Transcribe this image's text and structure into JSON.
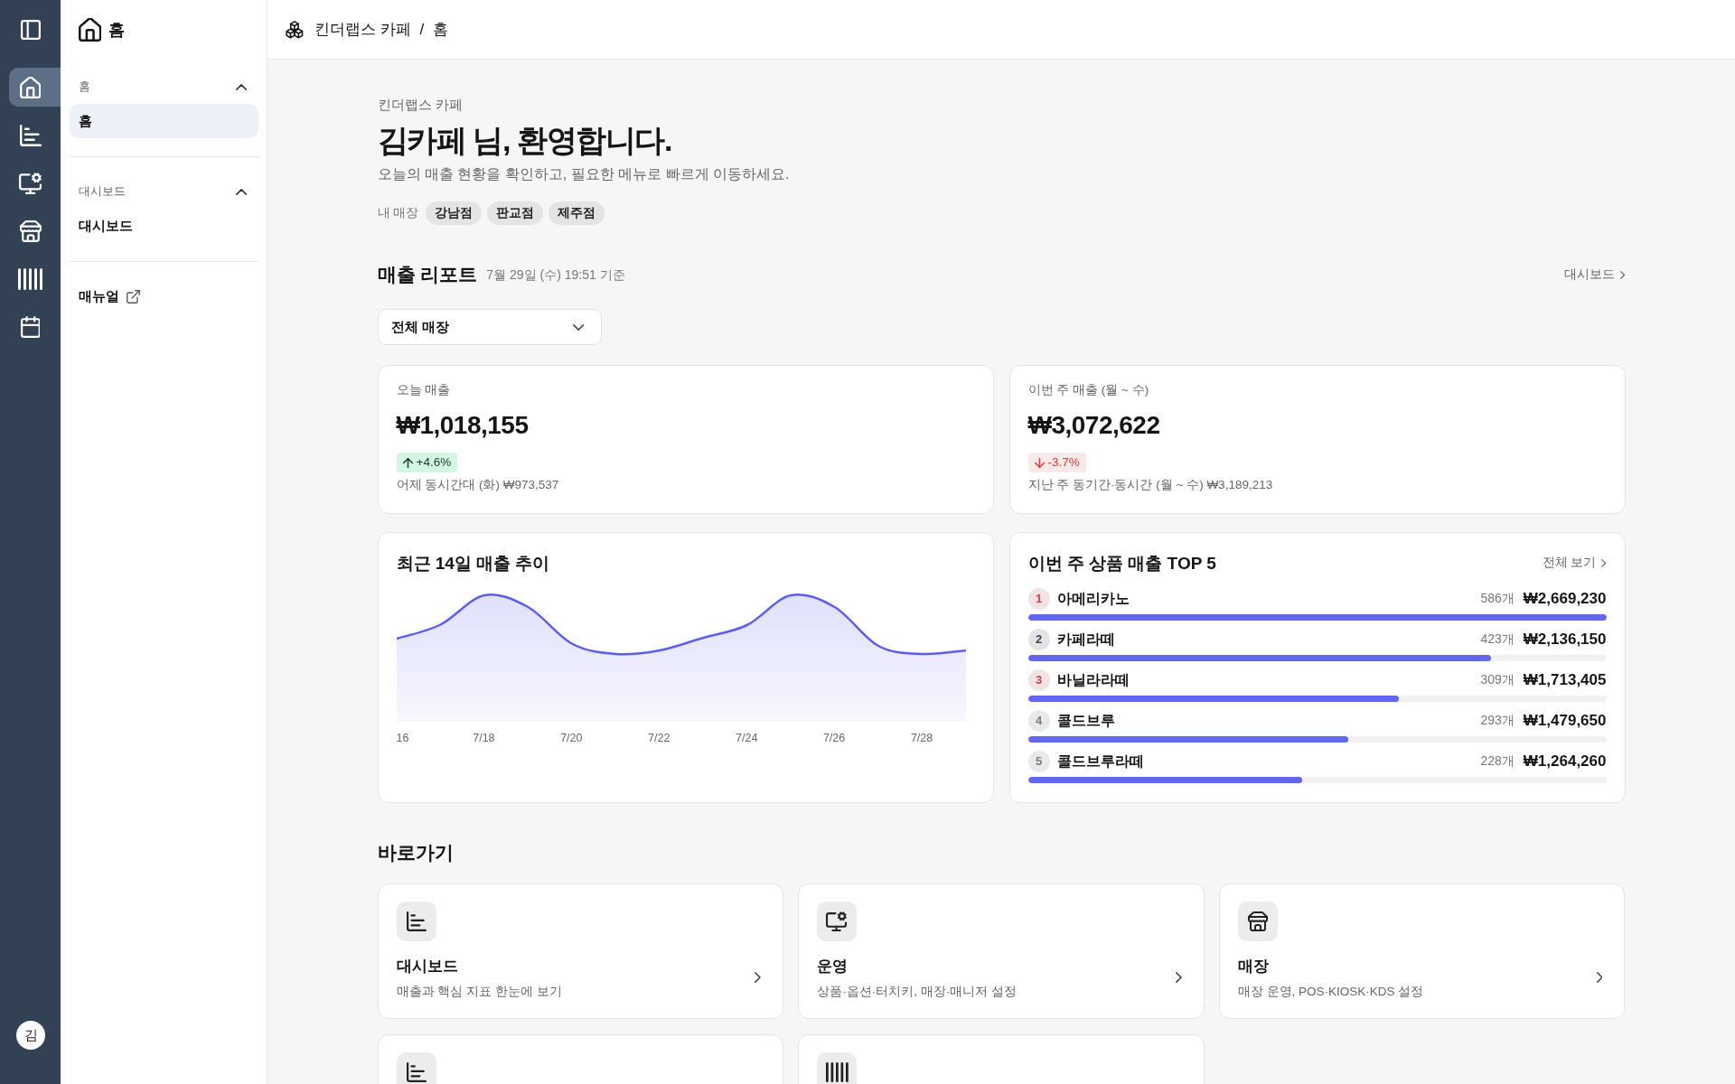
{
  "rail": {
    "items": [
      {
        "kind": "home",
        "selected": true
      },
      {
        "kind": "chart",
        "selected": false
      },
      {
        "kind": "monitor",
        "selected": false
      },
      {
        "kind": "store",
        "selected": false
      },
      {
        "kind": "barcode",
        "selected": false
      },
      {
        "kind": "calendar",
        "selected": false
      }
    ],
    "avatar": "김"
  },
  "sidebar": {
    "title": "홈",
    "groups": [
      {
        "label": "홈",
        "expanded": true,
        "items": [
          {
            "label": "홈",
            "selected": true
          }
        ]
      },
      {
        "label": "대시보드",
        "expanded": true,
        "items": [
          {
            "label": "대시보드",
            "selected": false
          }
        ]
      }
    ],
    "links": [
      {
        "label": "매뉴얼",
        "external": true
      }
    ]
  },
  "breadcrumb": {
    "items": [
      "킨더랩스 카페",
      "홈"
    ],
    "separator": "/"
  },
  "welcome": {
    "store_name": "킨더랩스 카페",
    "title": "김카페 님, 환영합니다.",
    "subtitle": "오늘의 매출 현황을 확인하고, 필요한 메뉴로 빠르게 이동하세요.",
    "stores_label": "내 매장",
    "stores": [
      "강남점",
      "판교점",
      "제주점"
    ]
  },
  "report": {
    "title": "매출 리포트",
    "timestamp": "7월 29일 (수) 19:51 기준",
    "link": "대시보드",
    "store_select": {
      "value": "전체 매장"
    },
    "kpis": [
      {
        "label": "오늘 매출",
        "value": "₩1,018,155",
        "increase": true,
        "change": "+4.6%",
        "comparison": "어제 동시간대 (화) ₩973,537"
      },
      {
        "label": "이번 주 매출 (월 ~ 수)",
        "value": "₩3,072,622",
        "increase": false,
        "change": "-3.7%",
        "comparison": "지난 주 동기간·동시간 (월 ~ 수) ₩3,189,213"
      }
    ],
    "trend_chart": {
      "title": "최근 14일 매출 추이",
      "x_labels": [
        "16",
        "7/18",
        "7/20",
        "7/22",
        "7/24",
        "7/26",
        "7/28"
      ]
    },
    "top_products": {
      "title": "이번 주 상품 매출 TOP 5",
      "link": "전체 보기",
      "items": [
        {
          "rank": "1",
          "color": "#d13f4a",
          "name": "아메리카노",
          "quantity": "586개",
          "amount": "₩2,669,230",
          "level": 1.0
        },
        {
          "rank": "2",
          "color": "#3b4254",
          "name": "카페라떼",
          "quantity": "423개",
          "amount": "₩2,136,150",
          "level": 0.8
        },
        {
          "rank": "3",
          "color": "#d13f4a",
          "name": "바닐라라떼",
          "quantity": "309개",
          "amount": "₩1,713,405",
          "level": 0.642
        },
        {
          "rank": "4",
          "color": "#7b7b7b",
          "name": "콜드브루",
          "quantity": "293개",
          "amount": "₩1,479,650",
          "level": 0.554
        },
        {
          "rank": "5",
          "color": "#7b7b7b",
          "name": "콜드브루라떼",
          "quantity": "228개",
          "amount": "₩1,264,260",
          "level": 0.474
        }
      ]
    }
  },
  "shortcuts": {
    "title": "바로가기",
    "cards": [
      {
        "kind": "chart",
        "title": "대시보드",
        "description": "매출과 핵심 지표 한눈에 보기"
      },
      {
        "kind": "monitor",
        "title": "운영",
        "description": "상품·옵션·터치키, 매장·매니저 설정"
      },
      {
        "kind": "store",
        "title": "매장",
        "description": "매장 운영, POS·KIOSK·KDS 설정"
      },
      {
        "kind": "chart"
      },
      {
        "kind": "barcode"
      }
    ]
  }
}
